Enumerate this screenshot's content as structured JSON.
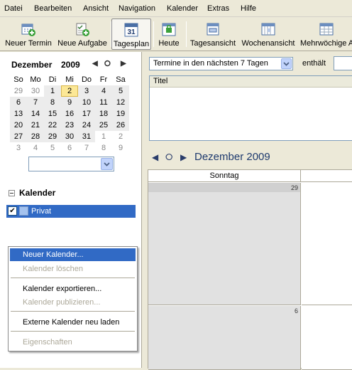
{
  "menubar": {
    "items": [
      "Datei",
      "Bearbeiten",
      "Ansicht",
      "Navigation",
      "Kalender",
      "Extras",
      "Hilfe"
    ]
  },
  "toolbar": {
    "buttons": [
      {
        "label": "Neuer Termin",
        "icon": "new-event-icon"
      },
      {
        "label": "Neue Aufgabe",
        "icon": "new-task-icon"
      },
      {
        "label": "Tagesplan",
        "icon": "day-plan-icon",
        "badge": "31"
      },
      {
        "label": "Heute",
        "icon": "today-icon"
      },
      {
        "label": "Tagesansicht",
        "icon": "day-view-icon"
      },
      {
        "label": "Wochenansicht",
        "icon": "week-view-icon"
      },
      {
        "label": "Mehrwöchige A",
        "icon": "multiweek-view-icon"
      }
    ]
  },
  "minical": {
    "month": "Dezember",
    "year": "2009",
    "weekdays": [
      "So",
      "Mo",
      "Di",
      "Mi",
      "Do",
      "Fr",
      "Sa"
    ],
    "weeks": [
      [
        "29",
        "30",
        "1",
        "2",
        "3",
        "4",
        "5"
      ],
      [
        "6",
        "7",
        "8",
        "9",
        "10",
        "11",
        "12"
      ],
      [
        "13",
        "14",
        "15",
        "16",
        "17",
        "18",
        "19"
      ],
      [
        "20",
        "21",
        "22",
        "23",
        "24",
        "25",
        "26"
      ],
      [
        "27",
        "28",
        "29",
        "30",
        "31",
        "1",
        "2"
      ],
      [
        "3",
        "4",
        "5",
        "6",
        "7",
        "8",
        "9"
      ]
    ],
    "today": "2"
  },
  "calendars": {
    "section_title": "Kalender",
    "items": [
      {
        "name": "Privat",
        "checked": true,
        "color": "#a4c2ee"
      }
    ]
  },
  "context_menu": {
    "items": [
      {
        "label": "Neuer Kalender...",
        "enabled": true,
        "highlighted": true
      },
      {
        "label": "Kalender löschen",
        "enabled": false
      },
      {
        "separator": true
      },
      {
        "label": "Kalender exportieren...",
        "enabled": true
      },
      {
        "label": "Kalender publizieren...",
        "enabled": false
      },
      {
        "separator": true
      },
      {
        "label": "Externe Kalender neu laden",
        "enabled": true
      },
      {
        "separator": true
      },
      {
        "label": "Eigenschaften",
        "enabled": false
      }
    ]
  },
  "events": {
    "filter_value": "Termine in den nächsten 7 Tagen",
    "contains_label": "enthält",
    "search_value": "",
    "column_title": "Titel"
  },
  "monthview": {
    "title": "Dezember 2009",
    "column_header": "Sonntag",
    "day_numbers": [
      "29",
      "6"
    ]
  }
}
